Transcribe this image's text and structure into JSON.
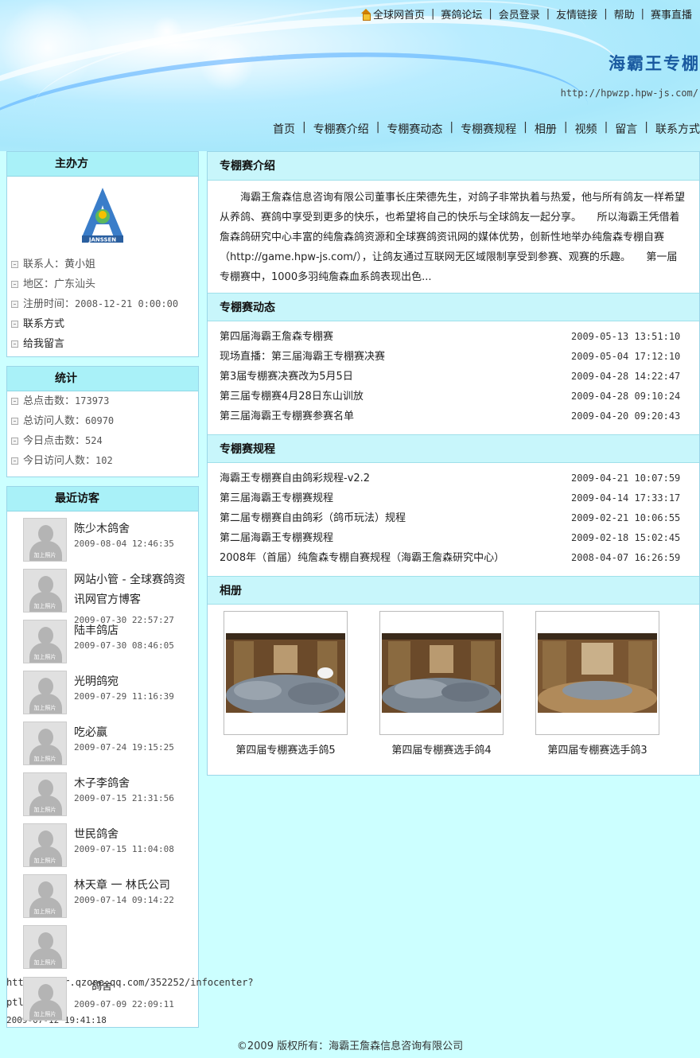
{
  "header": {
    "top_nav": [
      "全球网首页",
      "赛鸽论坛",
      "会员登录",
      "友情链接",
      "帮助",
      "赛事直播"
    ],
    "site_title": "海霸王专棚",
    "site_url": "http://hpwzp.hpw-js.com/",
    "main_nav": [
      "首页",
      "专棚赛介绍",
      "专棚赛动态",
      "专棚赛规程",
      "相册",
      "视频",
      "留言",
      "联系方式"
    ]
  },
  "organizer": {
    "heading": "主办方",
    "logo_text": "JANSSEN",
    "contact": "联系人：黄小姐",
    "region": "地区：广东汕头",
    "reg_label": "注册时间：",
    "reg_time": "2008-12-21 0:00:00",
    "contact_link": "联系方式",
    "message_link": "给我留言"
  },
  "stats": {
    "heading": "统计",
    "rows": [
      {
        "label": "总点击数：",
        "value": "173973"
      },
      {
        "label": "总访问人数：",
        "value": "60970"
      },
      {
        "label": "今日点击数：",
        "value": "524"
      },
      {
        "label": "今日访问人数：",
        "value": "102"
      }
    ]
  },
  "visitors": {
    "heading": "最近访客",
    "avatar_caption": "加上照片",
    "items": [
      {
        "name": "陈少木鸽舍",
        "time": "2009-08-04 12:46:35"
      },
      {
        "name": "网站小管 - 全球赛鸽资",
        "name2": "讯网官方博客",
        "time": "2009-07-30 22:57:27"
      },
      {
        "name": "陆丰鸽店",
        "time": "2009-07-30 08:46:05"
      },
      {
        "name": "光明鸽宛",
        "time": "2009-07-29 11:16:39"
      },
      {
        "name": "吃必赢",
        "time": "2009-07-24 19:15:25"
      },
      {
        "name": "木子李鸽舍",
        "time": "2009-07-15 21:31:56"
      },
      {
        "name": "世民鸽舍",
        "time": "2009-07-15 11:04:08"
      },
      {
        "name": "林天章 一 林氏公司",
        "time": "2009-07-14 09:14:22"
      }
    ],
    "overflow_url": "http://user.qzone.qq.com/352252/infocenter?",
    "overflow_url2": "ptl",
    "overflow_name": "鸽舍",
    "overflow_time": "2009-07-09 22:09:11",
    "overflow_time2": "2009-07-12 19:41:18"
  },
  "intro": {
    "heading": "专棚赛介绍",
    "text": "海霸王詹森信息咨询有限公司董事长庄荣德先生，对鸽子非常执着与热爱，他与所有鸽友一样希望从养鸽、赛鸽中享受到更多的快乐，也希望将自己的快乐与全球鸽友一起分享。　　所以海霸王凭借着詹森鸽研究中心丰富的纯詹森鸽资源和全球赛鸽资讯网的媒体优势，创新性地举办纯詹森专棚自赛（http://game.hpw-js.com/），让鸽友通过互联网无区域限制享受到参赛、观赛的乐趣。　　第一届专棚赛中，1000多羽纯詹森血系鸽表现出色..."
  },
  "news": {
    "heading": "专棚赛动态",
    "items": [
      {
        "title": "第四届海霸王詹森专棚赛",
        "date": "2009-05-13 13:51:10"
      },
      {
        "title": "现场直播：第三届海霸王专棚赛决赛",
        "date": "2009-05-04 17:12:10"
      },
      {
        "title": "第3届专棚赛决赛改为5月5日",
        "date": "2009-04-28 14:22:47"
      },
      {
        "title": "第三届专棚赛4月28日东山训放",
        "date": "2009-04-28 09:10:24"
      },
      {
        "title": "第三届海霸王专棚赛参赛名单",
        "date": "2009-04-20 09:20:43"
      }
    ]
  },
  "rules": {
    "heading": "专棚赛规程",
    "items": [
      {
        "title": "海霸王专棚赛自由鸽彩规程-v2.2",
        "date": "2009-04-21 10:07:59"
      },
      {
        "title": "第三届海霸王专棚赛规程",
        "date": "2009-04-14 17:33:17"
      },
      {
        "title": "第二届专棚赛自由鸽彩（鸽币玩法）规程",
        "date": "2009-02-21 10:06:55"
      },
      {
        "title": "第二届海霸王专棚赛规程",
        "date": "2009-02-18 15:02:45"
      },
      {
        "title": "2008年（首届）纯詹森专棚自赛规程（海霸王詹森研究中心）",
        "date": "2008-04-07 16:26:59"
      }
    ]
  },
  "album": {
    "heading": "相册",
    "items": [
      {
        "caption": "第四届专棚赛选手鸽5"
      },
      {
        "caption": "第四届专棚赛选手鸽4"
      },
      {
        "caption": "第四届专棚赛选手鸽3"
      }
    ]
  },
  "footer": {
    "text": "©2009 版权所有：海霸王詹森信息咨询有限公司"
  },
  "colors": {
    "page_bg": "#ccffff",
    "box_head": "#a9f1f8",
    "title": "#1a5aa0"
  }
}
